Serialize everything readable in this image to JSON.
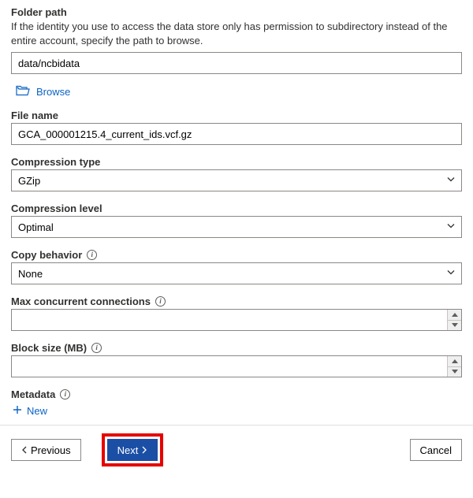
{
  "folderPath": {
    "label": "Folder path",
    "description": "If the identity you use to access the data store only has permission to subdirectory instead of the entire account, specify the path to browse.",
    "value": "data/ncbidata",
    "browseLabel": "Browse"
  },
  "fileName": {
    "label": "File name",
    "value": "GCA_000001215.4_current_ids.vcf.gz"
  },
  "compressionType": {
    "label": "Compression type",
    "value": "GZip"
  },
  "compressionLevel": {
    "label": "Compression level",
    "value": "Optimal"
  },
  "copyBehavior": {
    "label": "Copy behavior",
    "value": "None"
  },
  "maxConn": {
    "label": "Max concurrent connections",
    "value": ""
  },
  "blockSize": {
    "label": "Block size (MB)",
    "value": ""
  },
  "metadata": {
    "label": "Metadata",
    "newLabel": "New"
  },
  "footer": {
    "previous": "Previous",
    "next": "Next",
    "cancel": "Cancel"
  }
}
